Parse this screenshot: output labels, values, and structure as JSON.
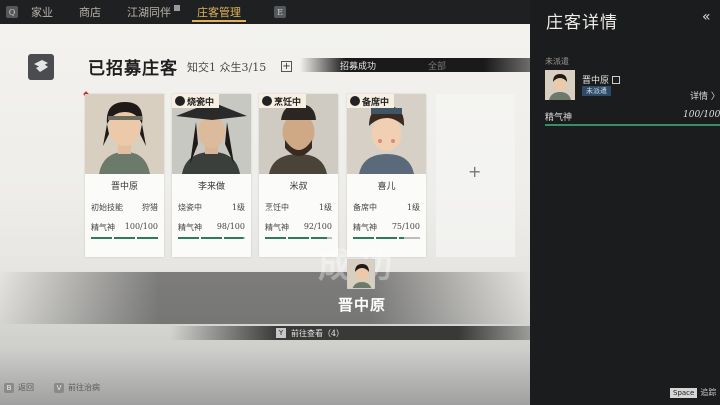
{
  "nav": {
    "left_key": "Q",
    "tabs": [
      {
        "label": "家业",
        "active": false
      },
      {
        "label": "商店",
        "active": false
      },
      {
        "label": "江湖同伴",
        "active": false
      },
      {
        "label": "庄客管理",
        "active": true
      }
    ],
    "right_key": "E"
  },
  "section": {
    "title": "已招募庄客",
    "stats": "知交1 众生3/15",
    "add_symbol": "+",
    "banner": "招募成功",
    "filter": "全部"
  },
  "cards": [
    {
      "name": "晋中原",
      "tag": "",
      "job_label": "初始技能",
      "job_value": "狩猎",
      "stat_label": "精气神",
      "stat_value": "100/100",
      "fill": 1.0
    },
    {
      "name": "李来做",
      "tag": "烧瓷中",
      "job_label": "烧瓷中",
      "job_value": "1级",
      "stat_label": "精气神",
      "stat_value": "98/100",
      "fill": 0.98
    },
    {
      "name": "米叔",
      "tag": "烹饪中",
      "job_label": "烹饪中",
      "job_value": "1级",
      "stat_label": "精气神",
      "stat_value": "92/100",
      "fill": 0.92
    },
    {
      "name": "喜儿",
      "tag": "备席中",
      "job_label": "备席中",
      "job_value": "1级",
      "stat_label": "精气神",
      "stat_value": "75/100",
      "fill": 0.75
    }
  ],
  "add_slot": "+",
  "popup": {
    "name": "晋中原",
    "goto_key": "Y",
    "goto_label": "前往查看（4）"
  },
  "hints": {
    "back_key": "B",
    "back_label": "返回",
    "heal_key": "V",
    "heal_label": "前往治病"
  },
  "detail_panel": {
    "title": "庄客详情",
    "back_icon": "«",
    "subheader": "未派遣",
    "name": "晋中原",
    "status": "未派遣",
    "detail_label": "详情 〉",
    "stat_label": "精气神",
    "stat_value": "100/100",
    "space_key": "Space",
    "space_label": "追踪"
  },
  "colors": {
    "accent": "#e0b45a",
    "stat_bar": "#2f7a5c",
    "status_badge": "#2e4a66"
  }
}
